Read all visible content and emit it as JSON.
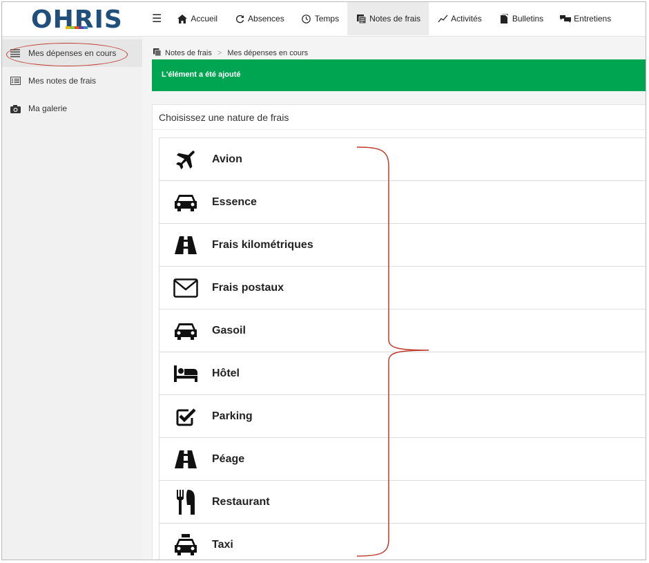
{
  "app": {
    "logo": "OHRIS"
  },
  "nav": {
    "items": [
      {
        "label": "Accueil",
        "icon": "home-icon"
      },
      {
        "label": "Absences",
        "icon": "refresh-icon"
      },
      {
        "label": "Temps",
        "icon": "clock-icon"
      },
      {
        "label": "Notes de frais",
        "icon": "note-icon",
        "active": true
      },
      {
        "label": "Activités",
        "icon": "chart-line-icon"
      },
      {
        "label": "Bulletins",
        "icon": "file-icon"
      },
      {
        "label": "Entretiens",
        "icon": "comments-icon"
      }
    ]
  },
  "sidebar": {
    "items": [
      {
        "label": "Mes dépenses en cours",
        "icon": "list-icon",
        "active": true
      },
      {
        "label": "Mes notes de frais",
        "icon": "table-list-icon"
      },
      {
        "label": "Ma galerie",
        "icon": "camera-icon"
      }
    ]
  },
  "breadcrumb": {
    "items": [
      "Notes de frais",
      "Mes dépenses en cours"
    ]
  },
  "alert": {
    "message": "L'élément a été ajouté",
    "color": "#00a551"
  },
  "panel": {
    "title": "Choisissez une nature de frais",
    "categories": [
      {
        "label": "Avion",
        "icon": "plane-icon"
      },
      {
        "label": "Essence",
        "icon": "car-icon"
      },
      {
        "label": "Frais kilométriques",
        "icon": "road-icon"
      },
      {
        "label": "Frais postaux",
        "icon": "envelope-icon"
      },
      {
        "label": "Gasoil",
        "icon": "car-icon"
      },
      {
        "label": "Hôtel",
        "icon": "bed-icon"
      },
      {
        "label": "Parking",
        "icon": "check-square-icon"
      },
      {
        "label": "Péage",
        "icon": "road-icon"
      },
      {
        "label": "Restaurant",
        "icon": "cutlery-icon"
      },
      {
        "label": "Taxi",
        "icon": "taxi-icon"
      }
    ]
  },
  "colors": {
    "annotation": "#c0392b",
    "logo_blue": "#1f4f7a"
  }
}
